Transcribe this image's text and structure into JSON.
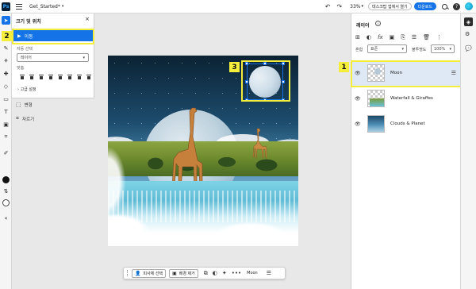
{
  "app": {
    "logo": "Ps",
    "document_name": "Get_Started*",
    "zoom": "33%",
    "open_desktop_label": "데스크탑 앱에서 열기",
    "download_label": "다운로드",
    "help_label": "?"
  },
  "properties": {
    "title": "크기 및 위치",
    "close": "×",
    "move_label": "이동",
    "auto_select_label": "자동 선택",
    "auto_select_value": "레이어",
    "align_label": "맞춤",
    "advanced_label": "고급 설정"
  },
  "side_tools": [
    {
      "label": "변형"
    },
    {
      "label": "자르기"
    }
  ],
  "annotations": {
    "badge1": "1",
    "badge2": "2",
    "badge3": "3"
  },
  "floatbar": {
    "select_subject": "피사체 선택",
    "remove_bg": "배경 제거",
    "more": "•••",
    "layer_name": "Moon"
  },
  "layers_panel": {
    "title": "레이어",
    "info": "i",
    "blend_label": "혼합",
    "blend_value": "표준",
    "opacity_label": "불투명도",
    "opacity_value": "100%",
    "layers": [
      {
        "name": "Moon",
        "selected": true
      },
      {
        "name": "Waterfall & Giraffes",
        "selected": false
      },
      {
        "name": "Clouds & Planet",
        "selected": false
      }
    ]
  },
  "colors": {
    "accent": "#1473e6",
    "highlight": "#f4ed3c",
    "selected_layer_bg": "#dfe9f6"
  },
  "icons": [
    "menu-icon",
    "undo-icon",
    "redo-icon",
    "search-icon",
    "help-icon",
    "avatar",
    "move-tool-icon",
    "eye-icon",
    "settings-icon"
  ]
}
